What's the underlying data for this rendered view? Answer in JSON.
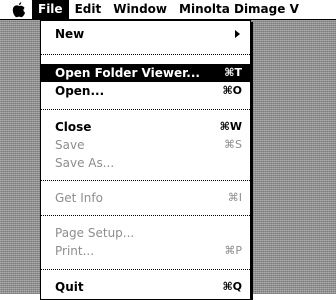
{
  "menubar": {
    "apple_icon": "apple-icon",
    "menus": [
      "File",
      "Edit",
      "Window",
      "Minolta Dimage V"
    ]
  },
  "file_menu": {
    "items": [
      {
        "label": "New",
        "shortcut": "",
        "submenu": true,
        "enabled": true
      },
      {
        "label": "Open Folder Viewer...",
        "shortcut": "⌘T",
        "enabled": true,
        "highlighted": true
      },
      {
        "label": "Open...",
        "shortcut": "⌘O",
        "enabled": true
      },
      {
        "label": "Close",
        "shortcut": "⌘W",
        "enabled": true
      },
      {
        "label": "Save",
        "shortcut": "⌘S",
        "enabled": false
      },
      {
        "label": "Save As...",
        "shortcut": "",
        "enabled": false
      },
      {
        "label": "Get Info",
        "shortcut": "⌘I",
        "enabled": false
      },
      {
        "label": "Page Setup...",
        "shortcut": "",
        "enabled": false
      },
      {
        "label": "Print...",
        "shortcut": "⌘P",
        "enabled": false
      },
      {
        "label": "Quit",
        "shortcut": "⌘Q",
        "enabled": true
      }
    ]
  },
  "colors": {
    "highlight": "#000000",
    "disabled_text": "#8e8e8e",
    "desktop": "#9a9a9a"
  }
}
